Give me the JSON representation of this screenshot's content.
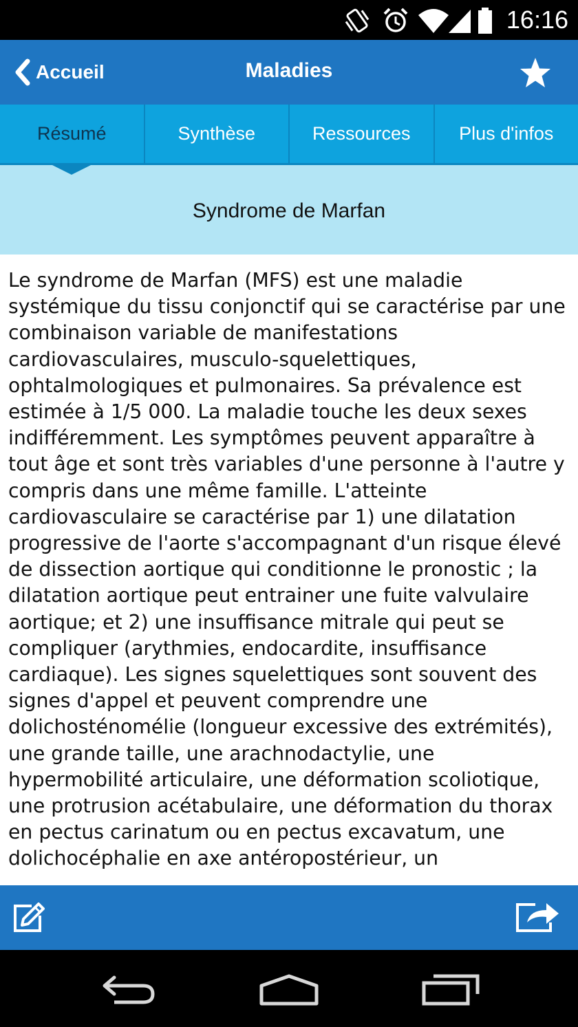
{
  "status_bar": {
    "time": "16:16"
  },
  "action_bar": {
    "back_label": "Accueil",
    "title": "Maladies",
    "favorite_icon": "star-icon"
  },
  "tabs": [
    {
      "label": "Résumé",
      "active": true
    },
    {
      "label": "Synthèse",
      "active": false
    },
    {
      "label": "Ressources",
      "active": false
    },
    {
      "label": "Plus d'infos",
      "active": false
    }
  ],
  "subject": {
    "title": "Syndrome de Marfan"
  },
  "content": {
    "body": "Le syndrome de Marfan (MFS) est une maladie systémique du tissu conjonctif qui se caractérise par une combinaison variable de manifestations cardiovasculaires, musculo-squelettiques, ophtalmologiques et pulmonaires. Sa prévalence est estimée à 1/5 000. La maladie touche les deux sexes indifféremment. Les symptômes peuvent apparaître à tout âge et sont très variables d'une personne à l'autre y compris dans une même famille. L'atteinte cardiovasculaire se caractérise par 1) une dilatation progressive de l'aorte s'accompagnant d'un risque élevé de dissection aortique qui conditionne le pronostic ; la dilatation aortique peut entrainer une fuite valvulaire aortique; et 2) une insuffisance mitrale qui peut se compliquer (arythmies, endocardite, insuffisance cardiaque). Les signes squelettiques sont souvent des signes d'appel et peuvent comprendre une dolichosténomélie (longueur excessive des extrémités), une grande taille, une arachnodactylie, une hypermobilité articulaire, une déformation scoliotique, une protrusion acétabulaire, une déformation du thorax en pectus carinatum ou en pectus excavatum, une dolichocéphalie en axe antéropostérieur, un"
  },
  "bottom_bar": {
    "left_icon": "edit-icon",
    "right_icon": "share-icon"
  },
  "colors": {
    "primary": "#1f76c2",
    "tab_bar": "#0ea3de",
    "subject_band": "#b3e5f5"
  }
}
